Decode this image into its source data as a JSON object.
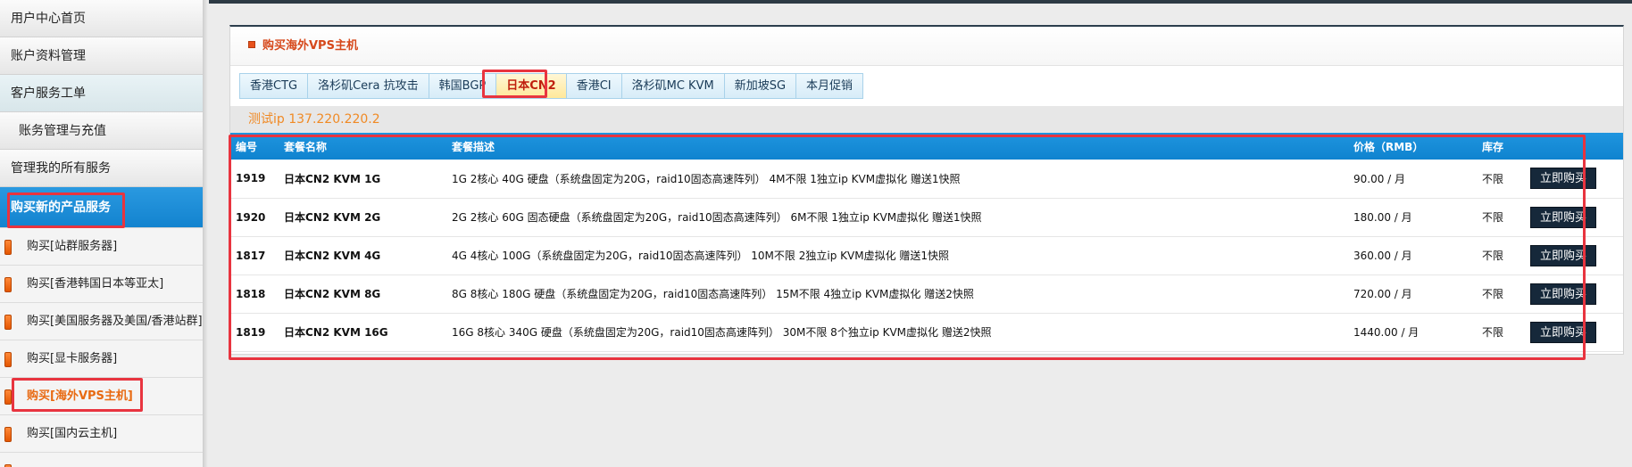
{
  "sidebar": {
    "items": [
      {
        "label": "用户中心首页"
      },
      {
        "label": "账户资料管理"
      },
      {
        "label": "客户服务工单"
      },
      {
        "label": "账务管理与充值"
      },
      {
        "label": "管理我的所有服务"
      },
      {
        "label": "购买新的产品服务"
      }
    ],
    "sub_items": [
      {
        "label": "购买[站群服务器]"
      },
      {
        "label": "购买[香港韩国日本等亚太]"
      },
      {
        "label": "购买[美国服务器及美国/香港站群]"
      },
      {
        "label": "购买[显卡服务器]"
      },
      {
        "label": "购买[海外VPS主机]"
      },
      {
        "label": "购买[国内云主机]"
      }
    ]
  },
  "panel": {
    "title": "购买海外VPS主机",
    "tabs": [
      {
        "label": "香港CTG"
      },
      {
        "label": "洛杉矶Cera 抗攻击"
      },
      {
        "label": "韩国BGP"
      },
      {
        "label": "日本CN2"
      },
      {
        "label": "香港CI"
      },
      {
        "label": "洛杉矶MC KVM"
      },
      {
        "label": "新加坡SG"
      },
      {
        "label": "本月促销"
      }
    ],
    "active_tab": "日本CN2",
    "test_ip": "测试ip 137.220.220.2"
  },
  "table": {
    "headers": {
      "id": "编号",
      "name": "套餐名称",
      "desc": "套餐描述",
      "price": "价格（RMB）",
      "stock": "库存"
    },
    "buy_label": "立即购买",
    "rows": [
      {
        "id": "1919",
        "name": "日本CN2 KVM 1G",
        "desc": "1G 2核心 40G 硬盘（系统盘固定为20G，raid10固态高速阵列） 4M不限 1独立ip KVM虚拟化 赠送1快照",
        "price": "90.00 / 月",
        "stock": "不限"
      },
      {
        "id": "1920",
        "name": "日本CN2 KVM 2G",
        "desc": "2G 2核心 60G 固态硬盘（系统盘固定为20G，raid10固态高速阵列） 6M不限 1独立ip KVM虚拟化 赠送1快照",
        "price": "180.00 / 月",
        "stock": "不限"
      },
      {
        "id": "1817",
        "name": "日本CN2 KVM 4G",
        "desc": "4G 4核心 100G（系统盘固定为20G，raid10固态高速阵列） 10M不限 2独立ip KVM虚拟化 赠送1快照",
        "price": "360.00 / 月",
        "stock": "不限"
      },
      {
        "id": "1818",
        "name": "日本CN2 KVM 8G",
        "desc": "8G 8核心 180G 硬盘（系统盘固定为20G，raid10固态高速阵列） 15M不限 4独立ip KVM虚拟化 赠送2快照",
        "price": "720.00 / 月",
        "stock": "不限"
      },
      {
        "id": "1819",
        "name": "日本CN2 KVM 16G",
        "desc": "16G 8核心 340G 硬盘（系统盘固定为20G，raid10固态高速阵列） 30M不限 8个独立ip KVM虚拟化 赠送2快照",
        "price": "1440.00 / 月",
        "stock": "不限"
      }
    ]
  },
  "colors": {
    "accent_blue": "#1383cf",
    "highlight_red": "#e8343f",
    "title_orange": "#d6481b",
    "button_dark": "#16283a"
  }
}
